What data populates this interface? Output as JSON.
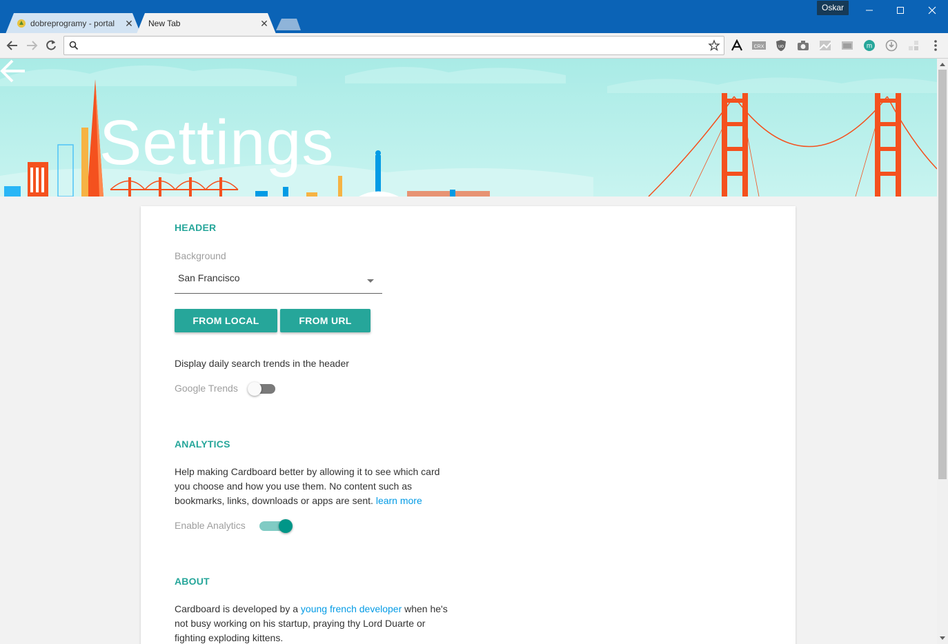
{
  "browser": {
    "profile_name": "Oskar",
    "tabs": [
      {
        "title": "dobreprogramy - portal"
      },
      {
        "title": "New Tab"
      }
    ],
    "address": {
      "value": "",
      "placeholder": ""
    }
  },
  "page": {
    "title": "Settings",
    "header_section": {
      "title": "HEADER",
      "background_label": "Background",
      "background_value": "San Francisco",
      "from_local_label": "FROM LOCAL",
      "from_url_label": "FROM URL",
      "trends_desc": "Display daily search trends in the header",
      "trends_label": "Google Trends",
      "trends_enabled": false
    },
    "analytics_section": {
      "title": "ANALYTICS",
      "desc": "Help making Cardboard better by allowing it to see which card you choose and how you use them. No content such as bookmarks, links, downloads or apps are sent.",
      "learn_more": "learn more",
      "enable_label": "Enable Analytics",
      "enabled": true
    },
    "about_section": {
      "title": "ABOUT",
      "text_before": "Cardboard is developed by a",
      "link_text": "young french developer",
      "text_after": "when he's not busy working on his startup, praying thy Lord Duarte or fighting exploding kittens."
    }
  },
  "colors": {
    "chrome_blue": "#0b63b6",
    "accent_teal": "#26a69a",
    "link_blue": "#039be5",
    "sky": "#b8eeea",
    "bridge_orange": "#f4511e"
  },
  "icons": [
    "back-icon",
    "forward-icon",
    "reload-icon",
    "search-icon",
    "star-icon",
    "more-icon",
    "minimize-icon",
    "maximize-icon",
    "close-icon"
  ]
}
